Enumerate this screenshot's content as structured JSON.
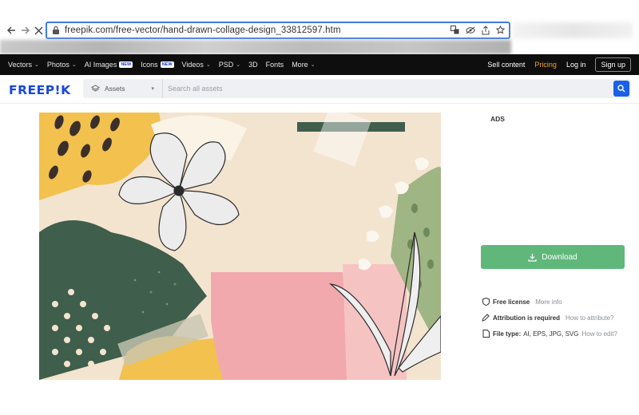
{
  "browser": {
    "url": "freepik.com/free-vector/hand-drawn-collage-design_33812597.htm"
  },
  "topnav": {
    "items": [
      {
        "label": "Vectors",
        "chevron": true,
        "badge": ""
      },
      {
        "label": "Photos",
        "chevron": true,
        "badge": ""
      },
      {
        "label": "AI Images",
        "chevron": false,
        "badge": "NEW"
      },
      {
        "label": "Icons",
        "chevron": false,
        "badge": "NEW"
      },
      {
        "label": "Videos",
        "chevron": true,
        "badge": ""
      },
      {
        "label": "PSD",
        "chevron": true,
        "badge": ""
      },
      {
        "label": "3D",
        "chevron": false,
        "badge": ""
      },
      {
        "label": "Fonts",
        "chevron": false,
        "badge": ""
      },
      {
        "label": "More",
        "chevron": true,
        "badge": ""
      }
    ],
    "sell_content": "Sell content",
    "pricing": "Pricing",
    "login": "Log in",
    "signup": "Sign up"
  },
  "header": {
    "logo": "FREEP!K",
    "assets_label": "Assets",
    "search_placeholder": "Search all assets"
  },
  "sidebar": {
    "ads_label": "ADS",
    "download_label": "Download",
    "license_label": "Free license",
    "license_link": "More info",
    "attribution_label": "Attribution is required",
    "attribution_link": "How to attribute?",
    "filetype_label": "File type:",
    "filetype_value": "AI, EPS, JPG, SVG",
    "filetype_link": "How to edit?"
  },
  "colors": {
    "accent_blue": "#1a47e0",
    "pricing_orange": "#f5a623",
    "download_green": "#5fb87a"
  }
}
